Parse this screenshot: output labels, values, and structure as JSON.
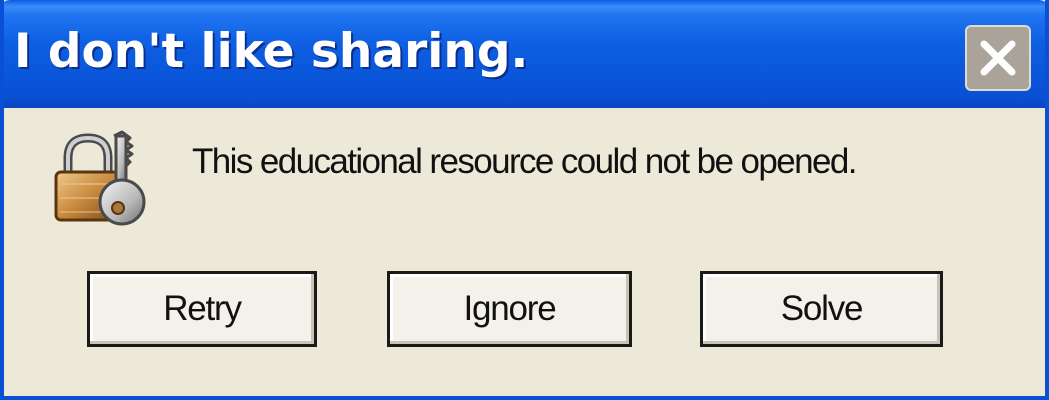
{
  "window": {
    "title": "I don't like sharing."
  },
  "dialog": {
    "icon": "padlock-key-icon",
    "message": "This educational resource could not be opened."
  },
  "buttons": {
    "retry": "Retry",
    "ignore": "Ignore",
    "solve": "Solve"
  },
  "colors": {
    "titlebar": "#0a56da",
    "body": "#ece9d8",
    "close_button": "#a9a39a"
  }
}
